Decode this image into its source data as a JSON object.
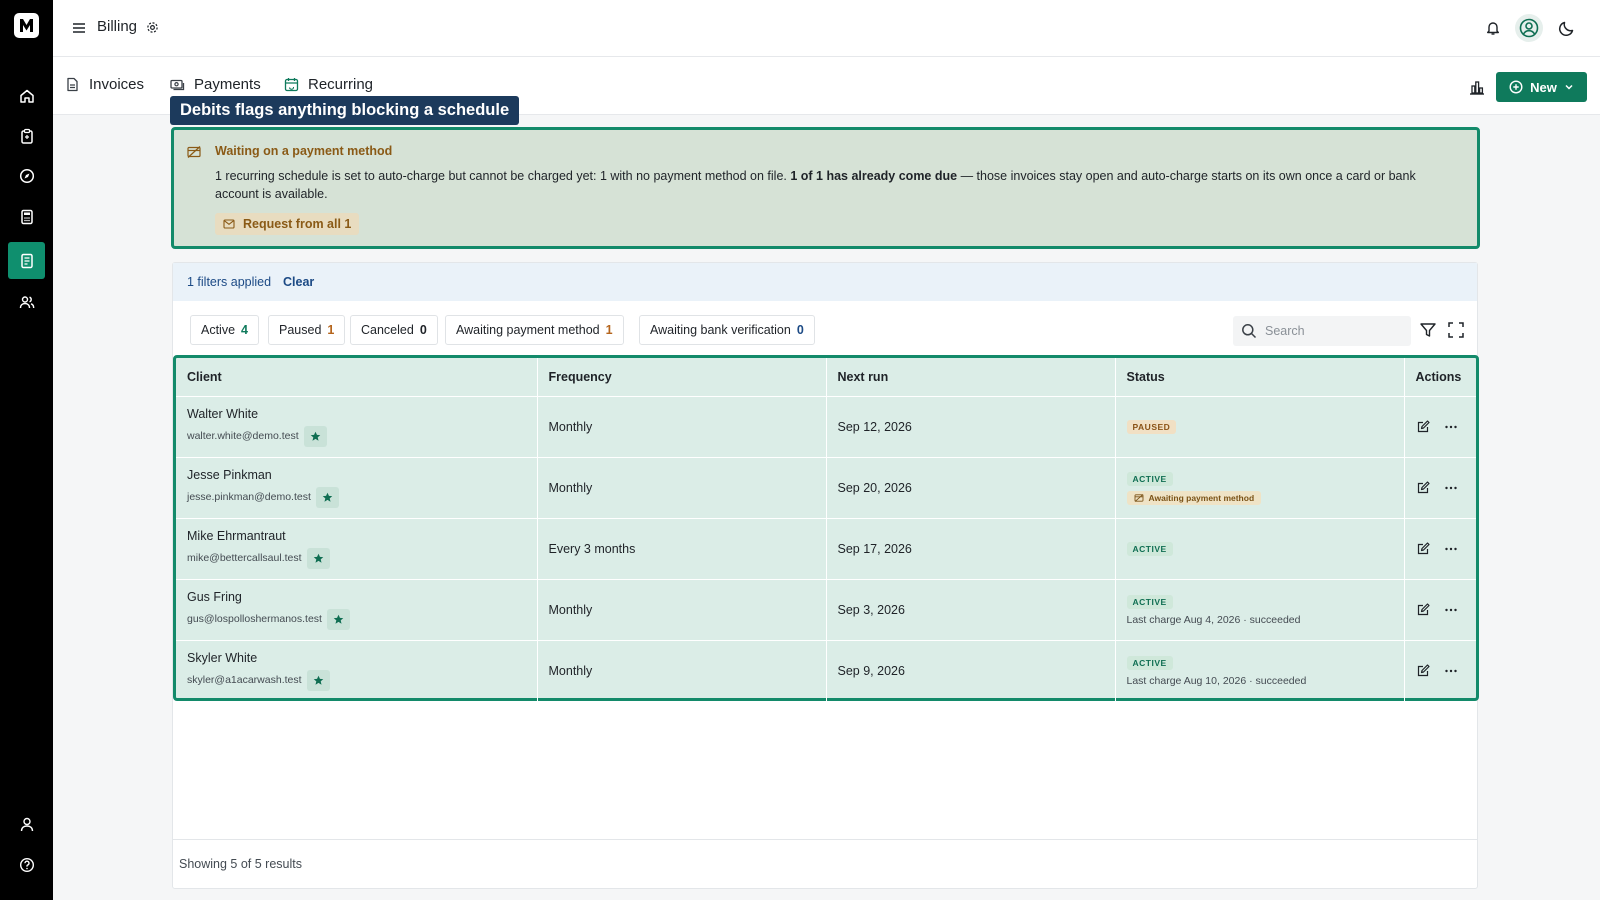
{
  "app": {
    "title": "Billing"
  },
  "tabs": [
    {
      "label": "Invoices",
      "icon": "document-icon"
    },
    {
      "label": "Payments",
      "icon": "money-icon"
    },
    {
      "label": "Recurring",
      "icon": "calendar-repeat-icon"
    }
  ],
  "new_button": {
    "label": "New"
  },
  "tooltip": {
    "text": "Debits flags anything blocking a schedule"
  },
  "notice": {
    "title": "Waiting on a payment method",
    "body_part1": "1 recurring schedule is set to auto-charge but cannot be charged yet: 1 with no payment method on file. ",
    "body_bold": "1 of 1 has already come due",
    "body_part2": " — those invoices stay open and auto-charge starts on its own once a card or bank account is available.",
    "button_label": "Request from all 1"
  },
  "filters": {
    "applied_text": "1 filters applied",
    "clear_label": "Clear"
  },
  "chips": [
    {
      "label": "Active",
      "count": "4",
      "color": "#0f7a5c"
    },
    {
      "label": "Paused",
      "count": "1",
      "color": "#b5651d"
    },
    {
      "label": "Canceled",
      "count": "0",
      "color": "#1f2328"
    },
    {
      "label": "Awaiting payment method",
      "count": "1",
      "color": "#b5651d"
    },
    {
      "label": "Awaiting bank verification",
      "count": "0",
      "color": "#1c4a85"
    }
  ],
  "search": {
    "placeholder": "Search"
  },
  "table": {
    "headers": [
      "Client",
      "Frequency",
      "Next run",
      "Status",
      "Actions"
    ],
    "rows": [
      {
        "name": "Walter White",
        "email": "walter.white@demo.test",
        "frequency": "Monthly",
        "next_run": "Sep 12, 2026",
        "status": "PAUSED",
        "sub_badge": "",
        "last_charge": ""
      },
      {
        "name": "Jesse Pinkman",
        "email": "jesse.pinkman@demo.test",
        "frequency": "Monthly",
        "next_run": "Sep 20, 2026",
        "status": "ACTIVE",
        "sub_badge": "Awaiting payment method",
        "last_charge": ""
      },
      {
        "name": "Mike Ehrmantraut",
        "email": "mike@bettercallsaul.test",
        "frequency": "Every 3 months",
        "next_run": "Sep 17, 2026",
        "status": "ACTIVE",
        "sub_badge": "",
        "last_charge": ""
      },
      {
        "name": "Gus Fring",
        "email": "gus@lospolloshermanos.test",
        "frequency": "Monthly",
        "next_run": "Sep 3, 2026",
        "status": "ACTIVE",
        "sub_badge": "",
        "last_charge": "Last charge Aug 4, 2026 · succeeded"
      },
      {
        "name": "Skyler White",
        "email": "skyler@a1acarwash.test",
        "frequency": "Monthly",
        "next_run": "Sep 9, 2026",
        "status": "ACTIVE",
        "sub_badge": "",
        "last_charge": "Last charge Aug 10, 2026 · succeeded"
      }
    ]
  },
  "footer": {
    "text": "Showing 5 of 5 results"
  }
}
